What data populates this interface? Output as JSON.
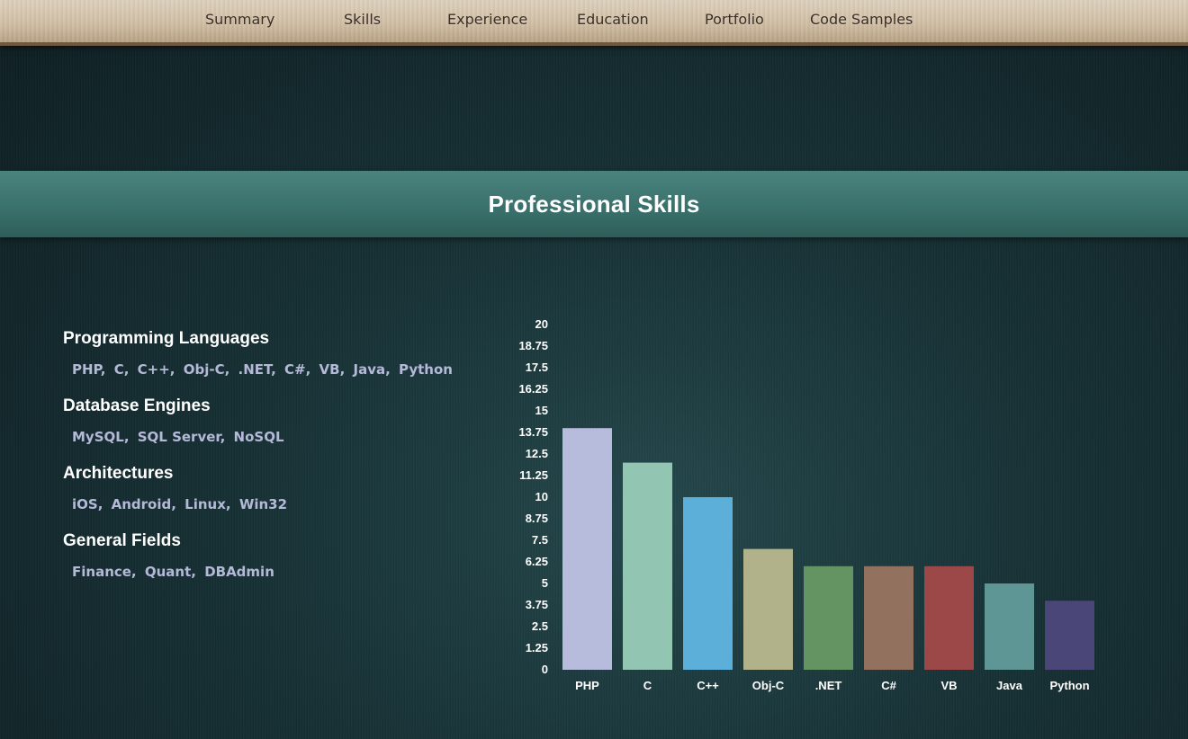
{
  "nav": {
    "items": [
      {
        "label": "Summary"
      },
      {
        "label": "Skills"
      },
      {
        "label": "Experience"
      },
      {
        "label": "Education"
      },
      {
        "label": "Portfolio"
      },
      {
        "label": "Code Samples"
      }
    ]
  },
  "section": {
    "title": "Professional Skills"
  },
  "skill_groups": [
    {
      "title": "Programming Languages",
      "items": [
        "PHP",
        "C",
        "C++",
        "Obj-C",
        ".NET",
        "C#",
        "VB",
        "Java",
        "Python"
      ]
    },
    {
      "title": "Database Engines",
      "items": [
        "MySQL",
        "SQL Server",
        "NoSQL"
      ]
    },
    {
      "title": "Architectures",
      "items": [
        "iOS",
        "Android",
        "Linux",
        "Win32"
      ]
    },
    {
      "title": "General Fields",
      "items": [
        "Finance",
        "Quant",
        "DBAdmin"
      ]
    }
  ],
  "chart_data": {
    "type": "bar",
    "title": "",
    "xlabel": "",
    "ylabel": "",
    "categories": [
      "PHP",
      "C",
      "C++",
      "Obj-C",
      ".NET",
      "C#",
      "VB",
      "Java",
      "Python"
    ],
    "values": [
      14,
      12,
      10,
      7,
      6,
      6,
      6,
      5,
      4
    ],
    "colors": [
      "#b8bcdc",
      "#93c5b3",
      "#5bafd8",
      "#b2b28a",
      "#659463",
      "#92725f",
      "#9c4849",
      "#5e9595",
      "#4a4678"
    ],
    "ylim": [
      0,
      20
    ],
    "yticks": [
      "0",
      "1.25",
      "2.5",
      "3.75",
      "5",
      "6.25",
      "7.5",
      "8.75",
      "10",
      "11.25",
      "12.5",
      "13.75",
      "15",
      "16.25",
      "17.5",
      "18.75",
      "20"
    ],
    "grid": false,
    "legend": "none"
  }
}
